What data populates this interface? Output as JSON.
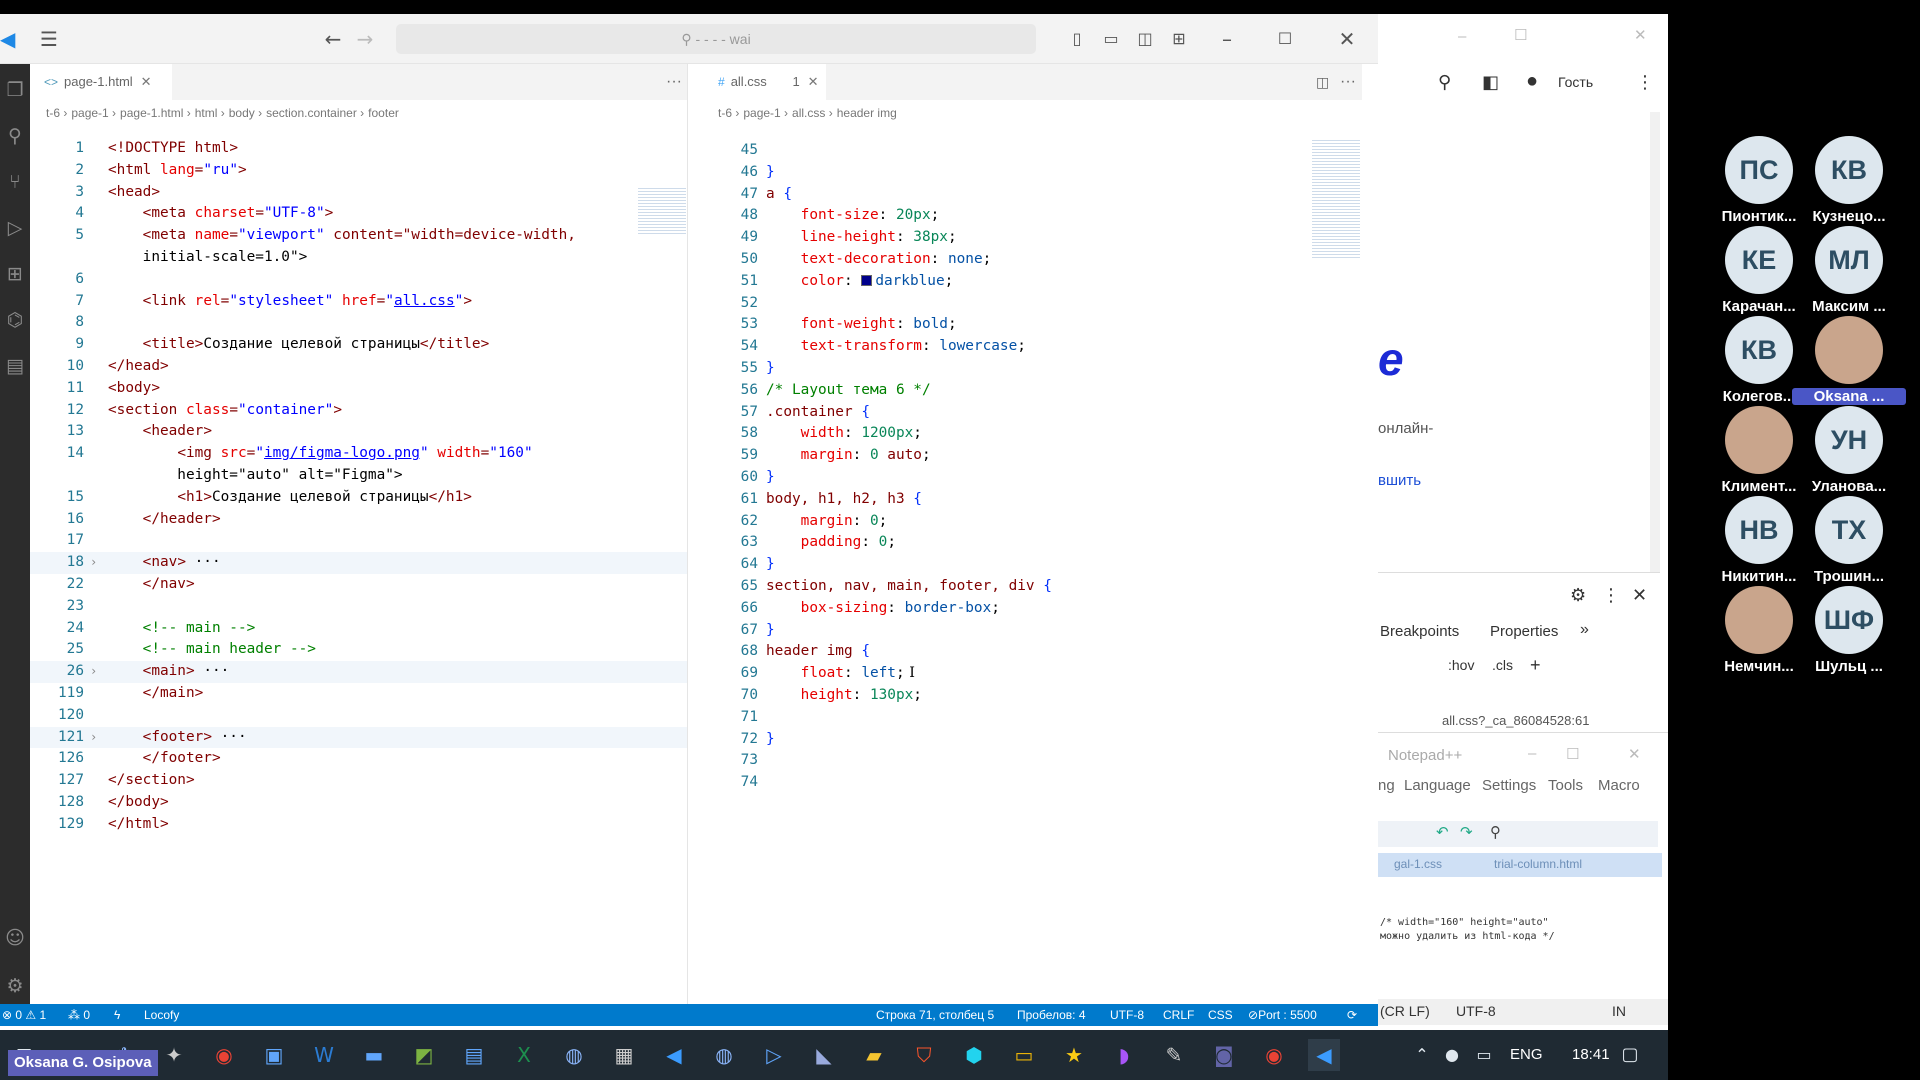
{
  "titlebar": {
    "search": "- - - - wai"
  },
  "left_editor": {
    "tab": "page-1.html",
    "breadcrumbs": [
      "t-6",
      "page-1",
      "page-1.html",
      "html",
      "body",
      "section.container",
      "footer"
    ],
    "lines": [
      {
        "n": "1",
        "t": "<!DOCTYPE html>"
      },
      {
        "n": "2",
        "t": "<html lang=\"ru\">"
      },
      {
        "n": "3",
        "t": "<head>"
      },
      {
        "n": "4",
        "t": "    <meta charset=\"UTF-8\">"
      },
      {
        "n": "5",
        "t": "    <meta name=\"viewport\" content=\"width=device-width,"
      },
      {
        "n": "",
        "t": "    initial-scale=1.0\">"
      },
      {
        "n": "6",
        "t": ""
      },
      {
        "n": "7",
        "t": "    <link rel=\"stylesheet\" href=\"all.css\">"
      },
      {
        "n": "8",
        "t": ""
      },
      {
        "n": "9",
        "t": "    <title>Создание целевой страницы</title>"
      },
      {
        "n": "10",
        "t": "</head>"
      },
      {
        "n": "11",
        "t": "<body>"
      },
      {
        "n": "12",
        "t": "<section class=\"container\">"
      },
      {
        "n": "13",
        "t": "    <header>"
      },
      {
        "n": "14",
        "t": "        <img src=\"img/figma-logo.png\" width=\"160\""
      },
      {
        "n": "",
        "t": "        height=\"auto\" alt=\"Figma\">"
      },
      {
        "n": "15",
        "t": "        <h1>Создание целевой страницы</h1>"
      },
      {
        "n": "16",
        "t": "    </header>"
      },
      {
        "n": "17",
        "t": ""
      },
      {
        "n": "18",
        "t": "    <nav> ···"
      },
      {
        "n": "22",
        "t": "    </nav>"
      },
      {
        "n": "23",
        "t": ""
      },
      {
        "n": "24",
        "t": "    <!-- main -->"
      },
      {
        "n": "25",
        "t": "    <!-- main header -->"
      },
      {
        "n": "26",
        "t": "    <main> ···"
      },
      {
        "n": "119",
        "t": "    </main>"
      },
      {
        "n": "120",
        "t": ""
      },
      {
        "n": "121",
        "t": "    <footer> ···"
      },
      {
        "n": "126",
        "t": "    </footer>"
      },
      {
        "n": "127",
        "t": "</section>"
      },
      {
        "n": "128",
        "t": "</body>"
      },
      {
        "n": "129",
        "t": "</html>"
      }
    ]
  },
  "right_editor": {
    "tab": "all.css",
    "tab_badge": "1",
    "breadcrumbs": [
      "t-6",
      "page-1",
      "all.css",
      "header img"
    ],
    "lines": [
      {
        "n": "45",
        "t": ""
      },
      {
        "n": "46",
        "t": "}"
      },
      {
        "n": "47",
        "t": "a {"
      },
      {
        "n": "48",
        "t": "    font-size: 20px;"
      },
      {
        "n": "49",
        "t": "    line-height: 38px;"
      },
      {
        "n": "50",
        "t": "    text-decoration: none;"
      },
      {
        "n": "51",
        "t": "    color: darkblue;"
      },
      {
        "n": "52",
        "t": ""
      },
      {
        "n": "53",
        "t": "    font-weight: bold;"
      },
      {
        "n": "54",
        "t": "    text-transform: lowercase;"
      },
      {
        "n": "55",
        "t": "}"
      },
      {
        "n": "56",
        "t": "/* Layout тема 6 */"
      },
      {
        "n": "57",
        "t": ".container {"
      },
      {
        "n": "58",
        "t": "    width: 1200px;"
      },
      {
        "n": "59",
        "t": "    margin: 0 auto;"
      },
      {
        "n": "60",
        "t": "}"
      },
      {
        "n": "61",
        "t": "body, h1, h2, h3 {"
      },
      {
        "n": "62",
        "t": "    margin: 0;"
      },
      {
        "n": "63",
        "t": "    padding: 0;"
      },
      {
        "n": "64",
        "t": "}"
      },
      {
        "n": "65",
        "t": "section, nav, main, footer, div {"
      },
      {
        "n": "66",
        "t": "    box-sizing: border-box;"
      },
      {
        "n": "67",
        "t": "}"
      },
      {
        "n": "68",
        "t": "header img {"
      },
      {
        "n": "69",
        "t": "    float: left;"
      },
      {
        "n": "70",
        "t": "    height: 130px;"
      },
      {
        "n": "71",
        "t": ""
      },
      {
        "n": "72",
        "t": "}"
      },
      {
        "n": "73",
        "t": ""
      },
      {
        "n": "74",
        "t": ""
      }
    ]
  },
  "statusbar": {
    "problems": "⊗ 0 ⚠ 1",
    "ports": "⁂ 0",
    "plugin": "Locofy",
    "position": "Строка 71, столбец 5",
    "spaces": "Пробелов: 4",
    "encoding": "UTF-8",
    "eol": "CRLF",
    "language": "CSS",
    "port": "Port : 5500"
  },
  "browser": {
    "guest": "Гость",
    "page_big": "e",
    "page_text1": "онлайн-",
    "page_text2": "вшить",
    "devtools_tabs": [
      "Breakpoints",
      "Properties"
    ],
    "devtools_tools": [
      ":hov",
      ".cls"
    ],
    "devtools_file": "all.css?_ca_86084528:61",
    "notepad_title": "Notepad++",
    "notepad_menu": [
      "ng",
      "Language",
      "Settings",
      "Tools",
      "Macro"
    ],
    "notepad_tabs": [
      "gal-1.css",
      "trial-column.html"
    ],
    "notepad_code": [
      "/* width=\"160\" height=\"auto\"",
      "можно удалить из html-кода */"
    ],
    "notepad_status": [
      "(CR LF)",
      "UTF-8",
      "IN"
    ]
  },
  "participants": [
    {
      "initials": "ПС",
      "name": "Пионтик..."
    },
    {
      "initials": "КВ",
      "name": "Кузнецо..."
    },
    {
      "initials": "КЕ",
      "name": "Карачан..."
    },
    {
      "initials": "МЛ",
      "name": "Максим ..."
    },
    {
      "initials": "КВ",
      "name": "Колегов..."
    },
    {
      "initials": "",
      "name": "Oksana ...",
      "active": true
    },
    {
      "initials": "",
      "name": "Климент..."
    },
    {
      "initials": "УН",
      "name": "Уланова..."
    },
    {
      "initials": "НВ",
      "name": "Никитин..."
    },
    {
      "initials": "ТХ",
      "name": "Трошин..."
    },
    {
      "initials": "",
      "name": "Немчин..."
    },
    {
      "initials": "ШФ",
      "name": "Шульц ..."
    }
  ],
  "taskbar": {
    "lang": "ENG",
    "time": "18:41",
    "presenter": "Oksana G. Osipova"
  },
  "colors": {
    "accent": "#007acc",
    "activity": "#2c2c2c",
    "taskbar": "#1f2a33",
    "presenter": "#5c5fb8"
  }
}
